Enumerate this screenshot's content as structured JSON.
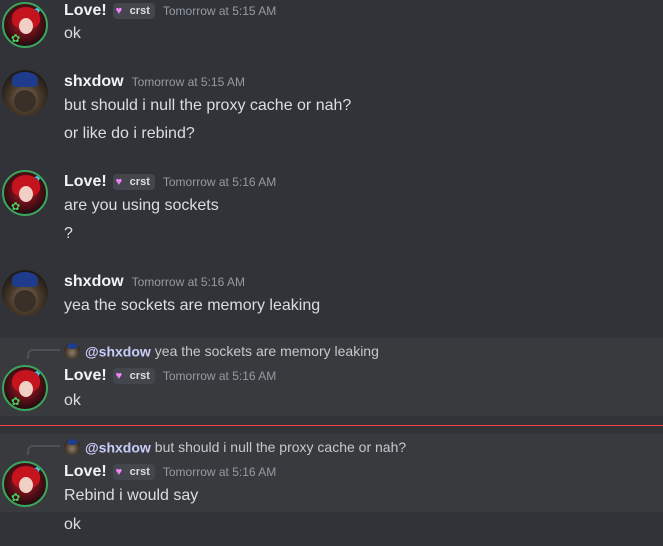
{
  "messages": [
    {
      "author": "Love!",
      "tag": "crst",
      "timestamp": "Tomorrow at 5:15 AM",
      "lines": [
        "ok"
      ]
    },
    {
      "author": "shxdow",
      "timestamp": "Tomorrow at 5:15 AM",
      "lines": [
        "but should i null the proxy cache or nah?",
        "or like do i rebind?"
      ]
    },
    {
      "author": "Love!",
      "tag": "crst",
      "timestamp": "Tomorrow at 5:16 AM",
      "lines": [
        "are you using sockets",
        "?"
      ]
    },
    {
      "author": "shxdow",
      "timestamp": "Tomorrow at 5:16 AM",
      "lines": [
        "yea the sockets are memory leaking"
      ]
    },
    {
      "reply": {
        "mention": "@shxdow",
        "text": "yea the sockets are memory leaking"
      },
      "author": "Love!",
      "tag": "crst",
      "timestamp": "Tomorrow at 5:16 AM",
      "lines": [
        "ok"
      ]
    },
    {
      "reply": {
        "mention": "@shxdow",
        "text": "but should i null the proxy cache or nah?"
      },
      "author": "Love!",
      "tag": "crst",
      "timestamp": "Tomorrow at 5:16 AM",
      "lines": [
        "Rebind i would say",
        "ok"
      ]
    }
  ],
  "icons": {
    "tag_heart": "heart-icon",
    "avatar_decoration": "sparkle-icon",
    "status_badge": "leaf-icon"
  },
  "colors": {
    "background": "#313338",
    "highlight": "#393a3d",
    "mention": "#c9cdfb",
    "new_messages_divider": "#f23f42",
    "timestamp": "#949ba4",
    "tag_heart": "#f47fff"
  }
}
